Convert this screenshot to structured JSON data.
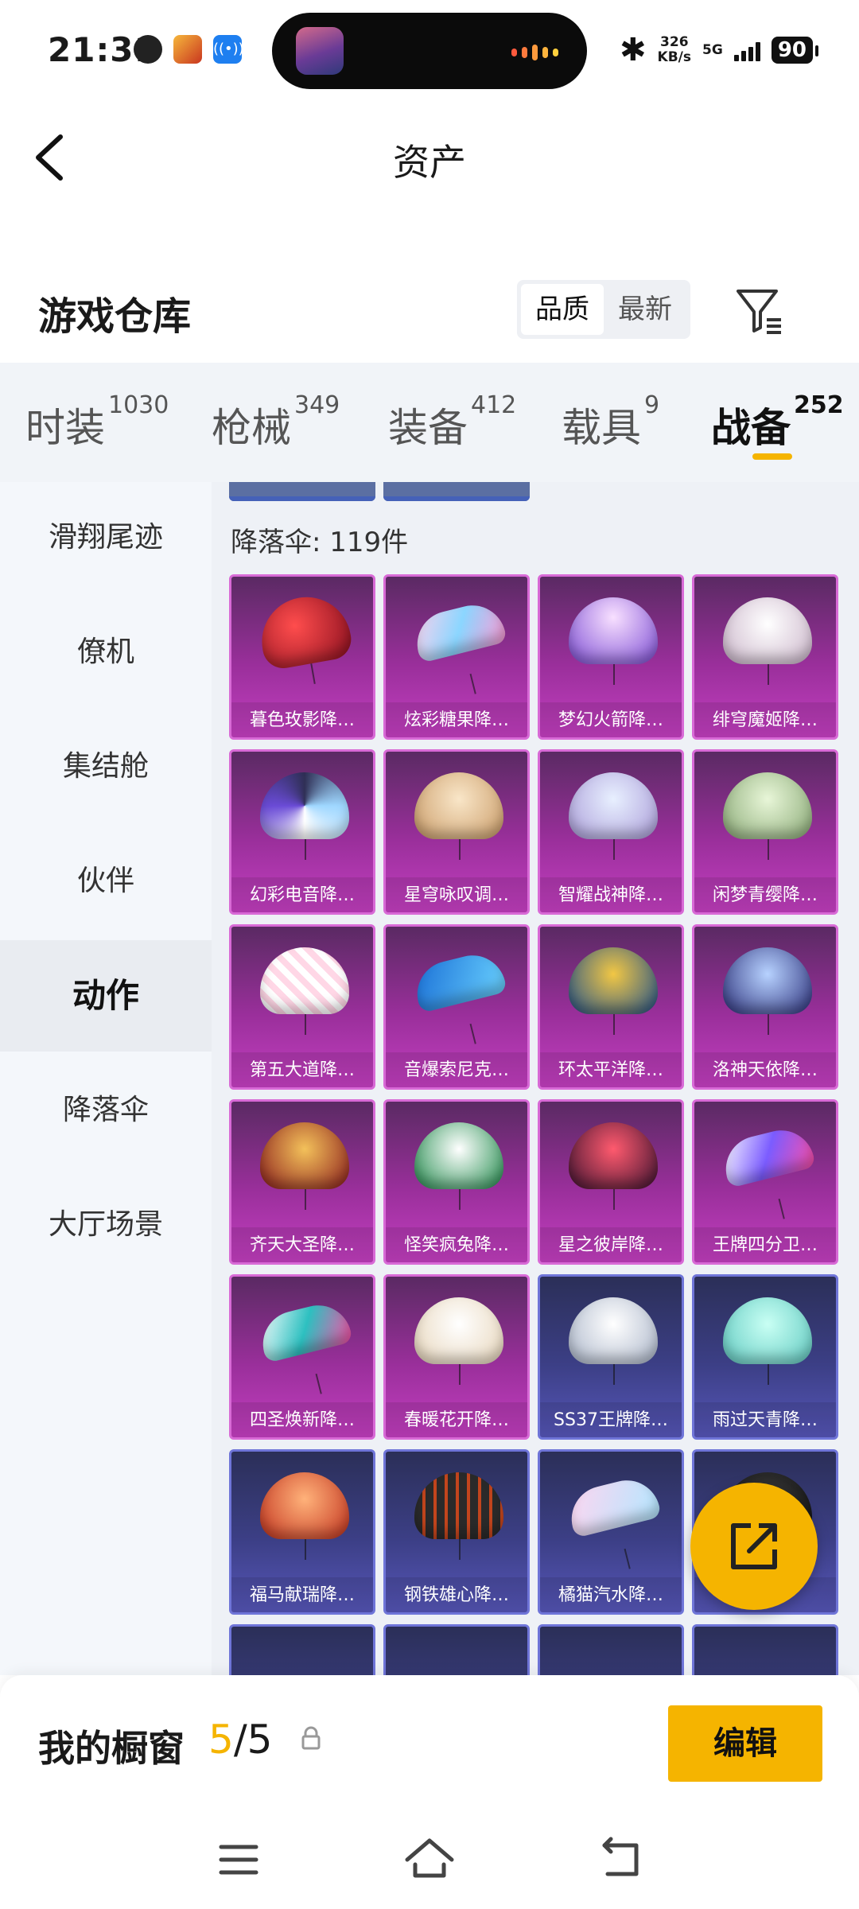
{
  "status_bar": {
    "time": "21:31",
    "speed_value": "326",
    "speed_unit": "KB/s",
    "network": "5G",
    "battery": "90"
  },
  "header": {
    "title": "资产",
    "back_icon": "chevron-left-icon"
  },
  "section": {
    "title": "游戏仓库",
    "sort_options": [
      "品质",
      "最新"
    ],
    "active_sort": "品质",
    "filter_icon": "filter-icon"
  },
  "category_tabs": [
    {
      "label": "时装",
      "count": "1030"
    },
    {
      "label": "枪械",
      "count": "349"
    },
    {
      "label": "装备",
      "count": "412"
    },
    {
      "label": "载具",
      "count": "9"
    },
    {
      "label": "战备",
      "count": "252",
      "active": true
    }
  ],
  "sidebar": {
    "items": [
      "滑翔尾迹",
      "僚机",
      "集结舱",
      "伙伴",
      "动作",
      "降落伞",
      "大厅场景"
    ],
    "active": "动作"
  },
  "content": {
    "count_label": "降落伞: 119件",
    "items": [
      {
        "name": "暮色玫影降…",
        "rarity": "purple"
      },
      {
        "name": "炫彩糖果降…",
        "rarity": "purple"
      },
      {
        "name": "梦幻火箭降…",
        "rarity": "purple"
      },
      {
        "name": "绯穹魔姬降…",
        "rarity": "purple"
      },
      {
        "name": "幻彩电音降…",
        "rarity": "purple"
      },
      {
        "name": "星穹咏叹调…",
        "rarity": "purple"
      },
      {
        "name": "智耀战神降…",
        "rarity": "purple"
      },
      {
        "name": "闲梦青缨降…",
        "rarity": "purple"
      },
      {
        "name": "第五大道降…",
        "rarity": "purple"
      },
      {
        "name": "音爆索尼克…",
        "rarity": "purple"
      },
      {
        "name": "环太平洋降…",
        "rarity": "purple"
      },
      {
        "name": "洛神天依降…",
        "rarity": "purple"
      },
      {
        "name": "齐天大圣降…",
        "rarity": "purple"
      },
      {
        "name": "怪笑疯兔降…",
        "rarity": "purple"
      },
      {
        "name": "星之彼岸降…",
        "rarity": "purple"
      },
      {
        "name": "王牌四分卫…",
        "rarity": "purple"
      },
      {
        "name": "四圣焕新降…",
        "rarity": "purple"
      },
      {
        "name": "春暖花开降…",
        "rarity": "purple"
      },
      {
        "name": "SS37王牌降…",
        "rarity": "blue"
      },
      {
        "name": "雨过天青降…",
        "rarity": "blue"
      },
      {
        "name": "福马献瑞降…",
        "rarity": "blue"
      },
      {
        "name": "钢铁雄心降…",
        "rarity": "blue"
      },
      {
        "name": "橘猫汽水降…",
        "rarity": "blue"
      },
      {
        "name": "",
        "rarity": "blue"
      }
    ]
  },
  "fab": {
    "icon": "share-external-icon"
  },
  "showcase": {
    "title": "我的橱窗",
    "current": "5",
    "total": "/5",
    "lock_icon": "lock-icon",
    "edit_label": "编辑"
  },
  "navbar": {
    "icons": [
      "menu-icon",
      "home-icon",
      "back-icon"
    ]
  },
  "colors": {
    "accent": "#f5b400",
    "purple_tile": "#b536b3",
    "blue_tile": "#4a4ea6",
    "sidebar_bg": "#f4f7fb"
  }
}
